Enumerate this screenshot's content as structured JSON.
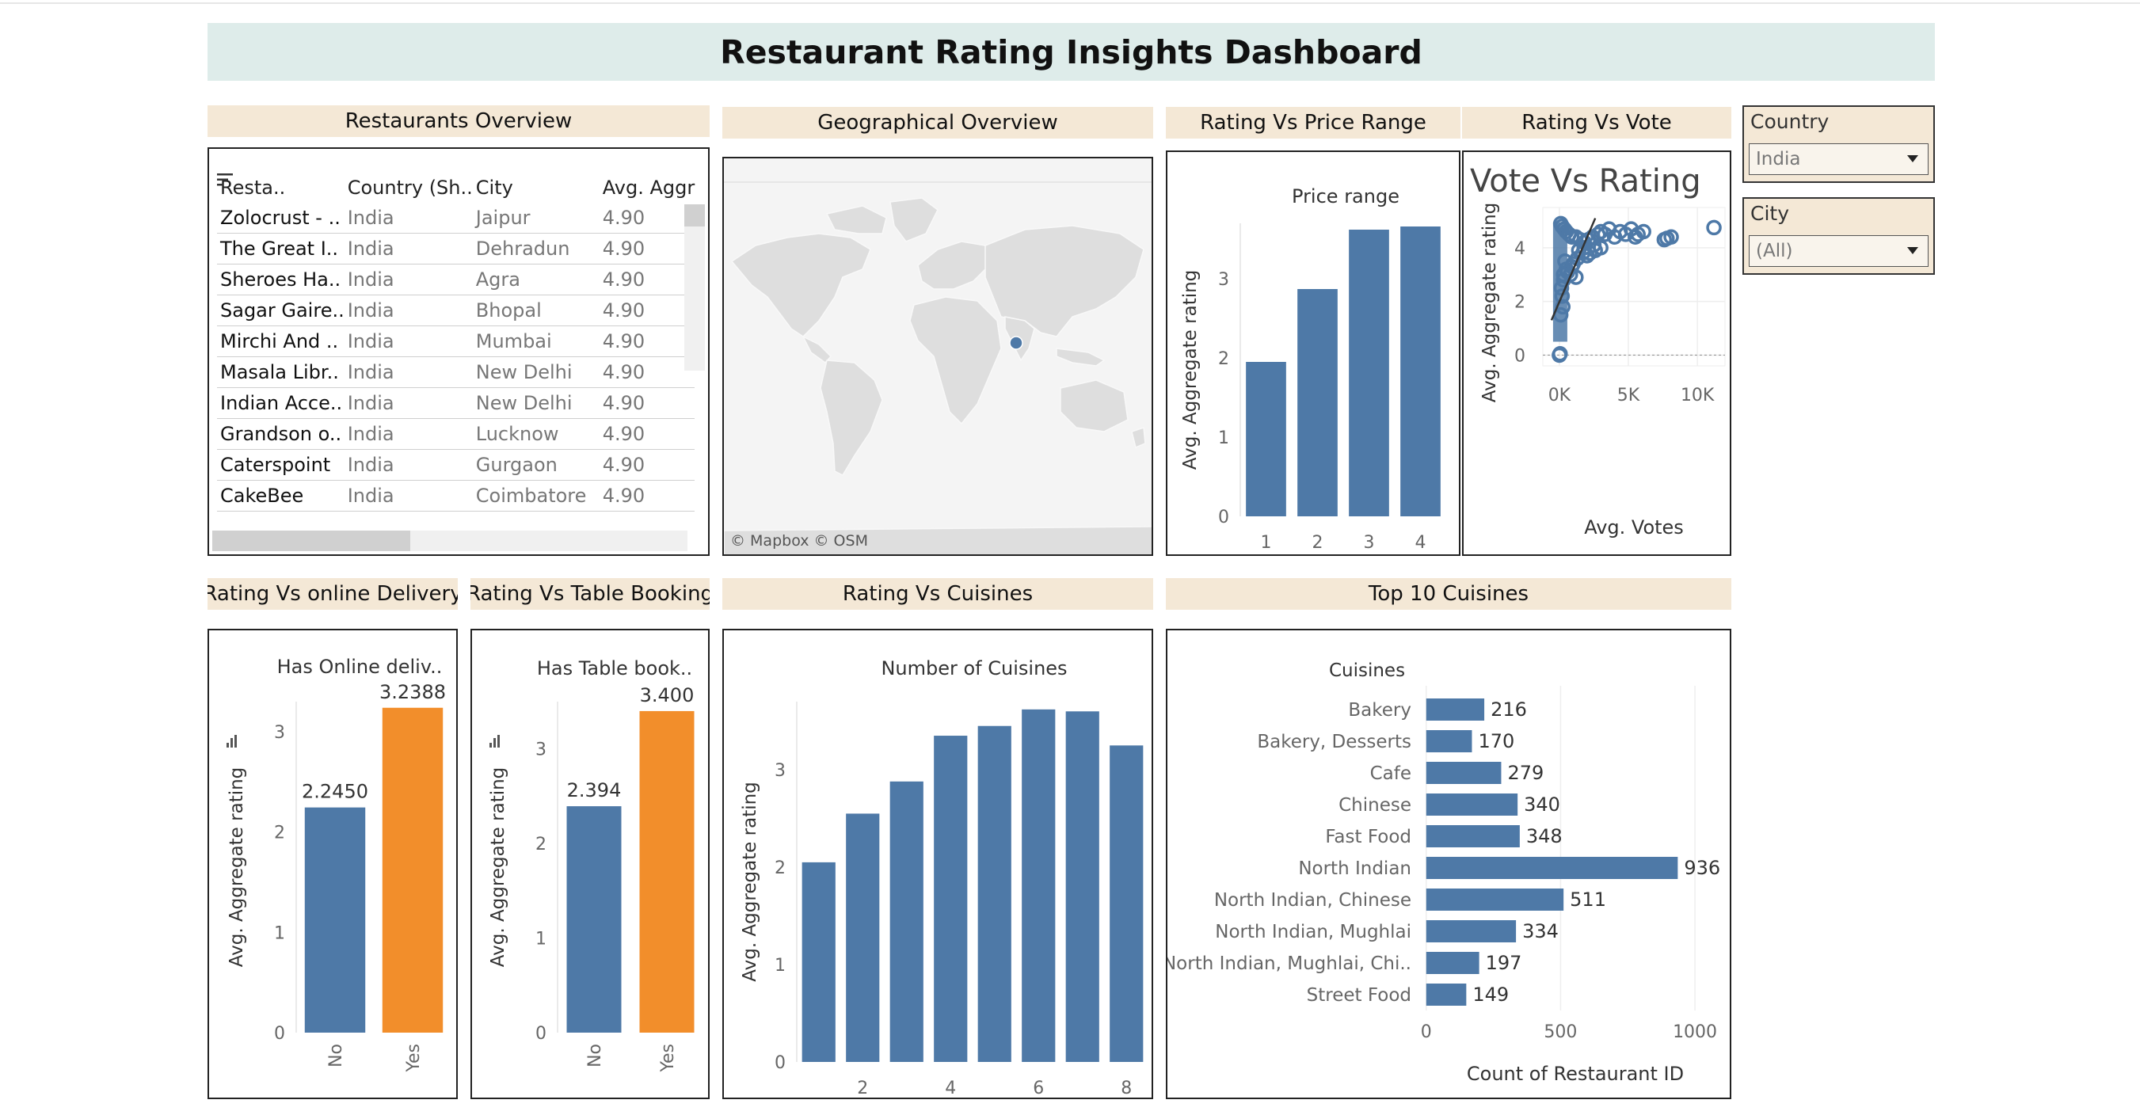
{
  "dashboard": {
    "title": "Restaurant Rating Insights Dashboard"
  },
  "headers": {
    "overview": "Restaurants Overview",
    "geo": "Geographical Overview",
    "price": "Rating Vs Price Range",
    "vote": "Rating Vs Vote",
    "delivery": "Rating Vs online Delivery",
    "booking": "Rating Vs Table Booking",
    "cuisines": "Rating Vs Cuisines",
    "top10": "Top 10 Cuisines"
  },
  "filters": {
    "country_label": "Country",
    "country_value": "India",
    "city_label": "City",
    "city_value": "(All)"
  },
  "overview": {
    "columns": [
      "Resta..",
      "Country (Sh..",
      "City",
      "Avg. Aggr"
    ],
    "rows": [
      [
        "Zolocrust - ..",
        "India",
        "Jaipur",
        "4.90"
      ],
      [
        "The Great I..",
        "India",
        "Dehradun",
        "4.90"
      ],
      [
        "Sheroes Ha..",
        "India",
        "Agra",
        "4.90"
      ],
      [
        "Sagar Gaire..",
        "India",
        "Bhopal",
        "4.90"
      ],
      [
        "Mirchi And ..",
        "India",
        "Mumbai",
        "4.90"
      ],
      [
        "Masala Libr..",
        "India",
        "New Delhi",
        "4.90"
      ],
      [
        "Indian Acce..",
        "India",
        "New Delhi",
        "4.90"
      ],
      [
        "Grandson o..",
        "India",
        "Lucknow",
        "4.90"
      ],
      [
        "Caterspoint",
        "India",
        "Gurgaon",
        "4.90"
      ],
      [
        "CakeBee",
        "India",
        "Coimbatore",
        "4.90"
      ]
    ]
  },
  "map": {
    "credit": "© Mapbox  © OSM",
    "marker": "India"
  },
  "chart_data": [
    {
      "id": "price",
      "type": "bar",
      "title": "Price range",
      "ylabel": "Avg. Aggregate rating",
      "xlabel": "",
      "categories": [
        "1",
        "2",
        "3",
        "4"
      ],
      "values": [
        1.95,
        2.87,
        3.62,
        3.66
      ],
      "ylim": [
        0,
        3.7
      ],
      "yticks": [
        "0",
        "1",
        "2",
        "3"
      ],
      "color": "#4e79a7"
    },
    {
      "id": "vote",
      "type": "scatter",
      "title": "Vote Vs Rating",
      "ylabel": "Avg. Aggregate rating",
      "xlabel": "Avg. Votes",
      "xticks": [
        "0K",
        "5K",
        "10K"
      ],
      "yticks": [
        "0",
        "2",
        "4"
      ],
      "xlim": [
        -1200,
        12000
      ],
      "ylim": [
        -0.4,
        5.5
      ],
      "color": "#4e79a7",
      "x": [
        100,
        200,
        350,
        500,
        700,
        900,
        1200,
        1500,
        1800,
        2100,
        2400,
        2800,
        3000,
        3300,
        3600,
        4000,
        4400,
        4800,
        5200,
        5500,
        5700,
        6100,
        7600,
        7800,
        8100,
        11200,
        1400,
        1700,
        2000,
        2600,
        400,
        900,
        1300,
        300,
        0,
        50,
        150,
        200,
        250,
        100,
        300,
        600,
        1000,
        1800,
        2500,
        3000,
        500,
        800,
        1200,
        2200
      ],
      "y": [
        4.9,
        4.8,
        4.7,
        4.6,
        4.5,
        4.4,
        4.4,
        4.3,
        4.2,
        4.3,
        4.4,
        4.5,
        4.6,
        4.5,
        4.7,
        4.4,
        4.6,
        4.5,
        4.7,
        4.4,
        4.5,
        4.6,
        4.3,
        4.35,
        4.4,
        4.75,
        3.9,
        3.8,
        3.7,
        3.9,
        3.5,
        3.3,
        3.6,
        3.0,
        0.0,
        0.05,
        2.5,
        2.2,
        1.8,
        1.5,
        2.8,
        3.1,
        3.4,
        4.0,
        4.1,
        4.0,
        3.2,
        3.0,
        2.9,
        3.8
      ],
      "trend": {
        "x": [
          0,
          2600
        ],
        "y": [
          1.3,
          5.1
        ]
      }
    },
    {
      "id": "delivery",
      "type": "bar",
      "title": "Has Online deliv..",
      "ylabel": "Avg. Aggregate rating",
      "categories": [
        "No",
        "Yes"
      ],
      "values": [
        2.245,
        3.2388
      ],
      "labels": [
        "2.2450",
        "3.2388"
      ],
      "ylim": [
        0,
        3.3
      ],
      "yticks": [
        "0",
        "1",
        "2",
        "3"
      ],
      "colors": [
        "#4e79a7",
        "#f28e2b"
      ]
    },
    {
      "id": "booking",
      "type": "bar",
      "title": "Has Table book..",
      "ylabel": "Avg. Aggregate rating",
      "categories": [
        "No",
        "Yes"
      ],
      "values": [
        2.394,
        3.4
      ],
      "labels": [
        "2.394",
        "3.400"
      ],
      "ylim": [
        0,
        3.5
      ],
      "yticks": [
        "0",
        "1",
        "2",
        "3"
      ],
      "colors": [
        "#4e79a7",
        "#f28e2b"
      ]
    },
    {
      "id": "cuisines",
      "type": "bar",
      "title": "Number of Cuisines",
      "ylabel": "Avg. Aggregate rating",
      "categories": [
        "1",
        "2",
        "3",
        "4",
        "5",
        "6",
        "7",
        "8"
      ],
      "values": [
        2.05,
        2.55,
        2.88,
        3.35,
        3.45,
        3.62,
        3.6,
        3.25
      ],
      "xtick_labels": [
        "",
        "2",
        "",
        "4",
        "",
        "6",
        "",
        "8"
      ],
      "ylim": [
        0,
        3.7
      ],
      "yticks": [
        "0",
        "1",
        "2",
        "3"
      ],
      "color": "#4e79a7"
    },
    {
      "id": "top10",
      "type": "bar",
      "orientation": "horizontal",
      "title": "Cuisines",
      "xlabel": "Count of Restaurant ID",
      "categories": [
        "Bakery",
        "Bakery, Desserts",
        "Cafe",
        "Chinese",
        "Fast Food",
        "North Indian",
        "North Indian, Chinese",
        "North Indian, Mughlai",
        "North Indian, Mughlai, Chi..",
        "Street Food"
      ],
      "values": [
        216,
        170,
        279,
        340,
        348,
        936,
        511,
        334,
        197,
        149
      ],
      "xlim": [
        -20,
        1100
      ],
      "xticks": [
        "0",
        "500",
        "1000"
      ],
      "color": "#4e79a7"
    }
  ]
}
